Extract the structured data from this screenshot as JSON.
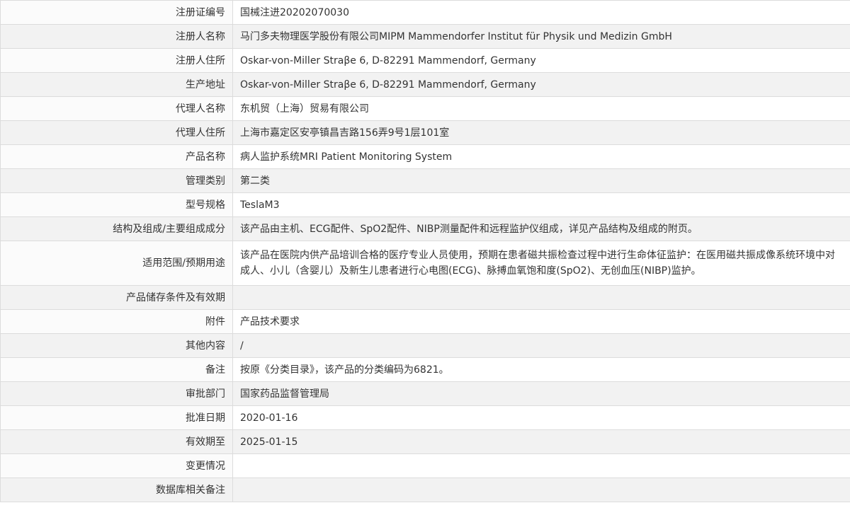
{
  "rows": [
    {
      "label": "注册证编号",
      "value": "国械注进20202070030"
    },
    {
      "label": "注册人名称",
      "value": "马门多夫物理医学股份有限公司MIPM Mammendorfer Institut für Physik und Medizin GmbH"
    },
    {
      "label": "注册人住所",
      "value": "Oskar-von-Miller Straβe 6, D-82291 Mammendorf, Germany"
    },
    {
      "label": "生产地址",
      "value": "Oskar-von-Miller Straβe 6, D-82291 Mammendorf, Germany"
    },
    {
      "label": "代理人名称",
      "value": "东机贸（上海）贸易有限公司"
    },
    {
      "label": "代理人住所",
      "value": "上海市嘉定区安亭镇昌吉路156弄9号1层101室"
    },
    {
      "label": "产品名称",
      "value": "病人监护系统MRI Patient Monitoring System"
    },
    {
      "label": "管理类别",
      "value": "第二类"
    },
    {
      "label": "型号规格",
      "value": "TeslaM3"
    },
    {
      "label": "结构及组成/主要组成成分",
      "value": "该产品由主机、ECG配件、SpO2配件、NIBP测量配件和远程监护仪组成，详见产品结构及组成的附页。"
    },
    {
      "label": "适用范围/预期用途",
      "value": "该产品在医院内供产品培训合格的医疗专业人员使用，预期在患者磁共振检查过程中进行生命体征监护：在医用磁共振成像系统环境中对成人、小儿（含婴儿）及新生儿患者进行心电图(ECG)、脉搏血氧饱和度(SpO2)、无创血压(NIBP)监护。"
    },
    {
      "label": "产品储存条件及有效期",
      "value": ""
    },
    {
      "label": "附件",
      "value": "产品技术要求"
    },
    {
      "label": "其他内容",
      "value": "/"
    },
    {
      "label": "备注",
      "value": "按原《分类目录》，该产品的分类编码为6821。"
    },
    {
      "label": "审批部门",
      "value": "国家药品监督管理局"
    },
    {
      "label": "批准日期",
      "value": "2020-01-16"
    },
    {
      "label": "有效期至",
      "value": "2025-01-15"
    },
    {
      "label": "变更情况",
      "value": ""
    },
    {
      "label": "数据库相关备注",
      "value": ""
    }
  ]
}
